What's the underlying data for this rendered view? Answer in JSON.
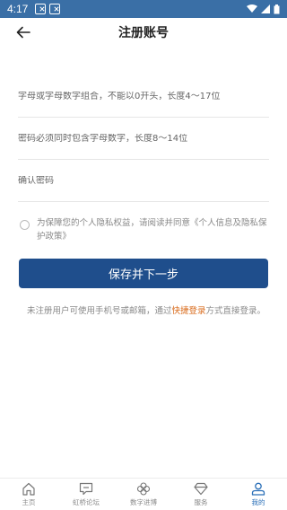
{
  "status_bar": {
    "time": "4:17"
  },
  "header": {
    "title": "注册账号"
  },
  "form": {
    "username_placeholder": "字母或字母数字组合，不能以0开头，长度4～17位",
    "password_placeholder": "密码必须同时包含字母数字，长度8～14位",
    "confirm_placeholder": "确认密码"
  },
  "agreement": {
    "text": "为保障您的个人隐私权益，请阅读并同意《个人信息及隐私保护政策》",
    "checked": false
  },
  "submit_label": "保存并下一步",
  "note": {
    "before": "未注册用户可使用手机号或邮箱，通过",
    "link": "快捷登录",
    "after": "方式直接登录。"
  },
  "tabs": [
    {
      "label": "主页",
      "icon": "home-icon"
    },
    {
      "label": "虹桥论坛",
      "icon": "forum-icon"
    },
    {
      "label": "数字进博",
      "icon": "clover-icon"
    },
    {
      "label": "服务",
      "icon": "diamond-icon"
    },
    {
      "label": "我的",
      "icon": "person-icon",
      "active": true
    }
  ],
  "colors": {
    "status_bar": "#3a6fa6",
    "primary": "#1f4e8c",
    "link": "#d96a1a",
    "active_tab": "#2a6fb8"
  }
}
